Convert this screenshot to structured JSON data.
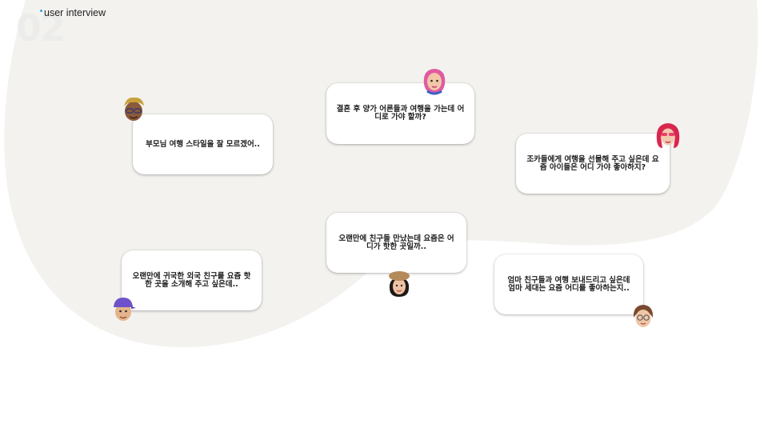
{
  "header": {
    "section_number": "02",
    "title": "user interview"
  },
  "quotes": [
    {
      "text": "부모님 여행 스타일을 잘 모르겠어..",
      "avatar": "memoji-man-curly-hair-icon"
    },
    {
      "text": "결혼 후 양가 어른들과 여행을 가는데 어디로 가야 할까?",
      "avatar": "memoji-woman-pink-hair-icon"
    },
    {
      "text": "조카들에게 여행을 선물해 주고 싶은데 요즘 아이들은 어디 가야 좋아하지?",
      "avatar": "memoji-woman-red-hair-icon"
    },
    {
      "text": "오랜만에 친구들 만났는데 요즘은 어디가 핫한 곳일까..",
      "avatar": "memoji-woman-beret-icon"
    },
    {
      "text": "오랜만에 귀국한 외국 친구를 요즘 핫한 곳을 소개해 주고 싶은데..",
      "avatar": "memoji-boy-purple-cap-icon"
    },
    {
      "text": "엄마 친구들과 여행 보내드리고 싶은데 엄마 세대는 요즘 어디를 좋아하는지..",
      "avatar": "memoji-girl-glasses-icon"
    }
  ],
  "colors": {
    "background": "#ffffff",
    "blob": "#f3f2ef",
    "accent": "#29a8e0"
  }
}
